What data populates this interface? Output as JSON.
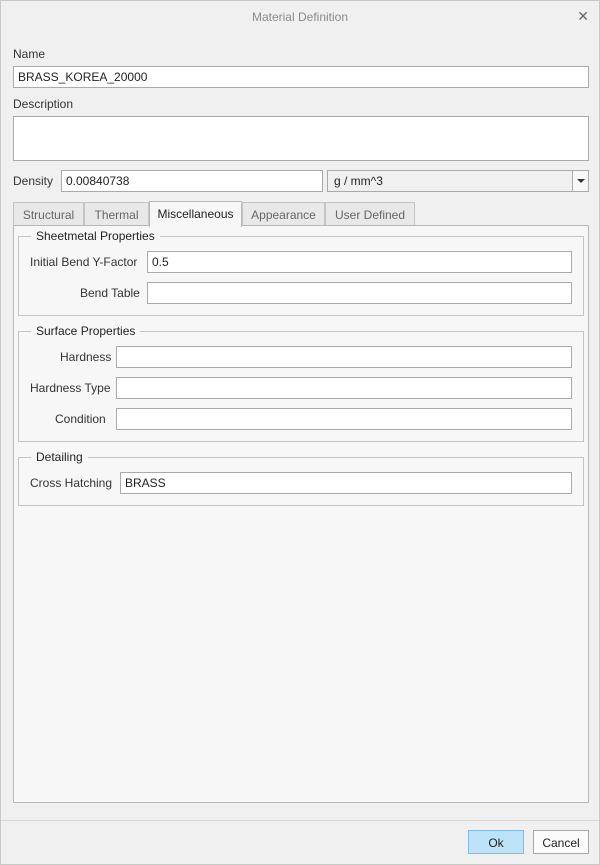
{
  "window": {
    "title": "Material Definition"
  },
  "name": {
    "label": "Name",
    "value": "BRASS_KOREA_20000"
  },
  "description": {
    "label": "Description",
    "value": ""
  },
  "density": {
    "label": "Density",
    "value": "0.00840738",
    "unit": "g / mm^3"
  },
  "tabs": [
    {
      "label": "Structural"
    },
    {
      "label": "Thermal"
    },
    {
      "label": "Miscellaneous"
    },
    {
      "label": "Appearance"
    },
    {
      "label": "User Defined"
    }
  ],
  "active_tab": "Miscellaneous",
  "sheetmetal": {
    "title": "Sheetmetal Properties",
    "y_factor_label": "Initial Bend Y-Factor",
    "y_factor_value": "0.5",
    "bend_table_label": "Bend Table",
    "bend_table_value": ""
  },
  "surface": {
    "title": "Surface Properties",
    "hardness_label": "Hardness",
    "hardness_value": "",
    "hardness_type_label": "Hardness Type",
    "hardness_type_value": "",
    "condition_label": "Condition",
    "condition_value": ""
  },
  "detailing": {
    "title": "Detailing",
    "cross_hatching_label": "Cross Hatching",
    "cross_hatching_value": "BRASS"
  },
  "buttons": {
    "ok": "Ok",
    "cancel": "Cancel"
  }
}
